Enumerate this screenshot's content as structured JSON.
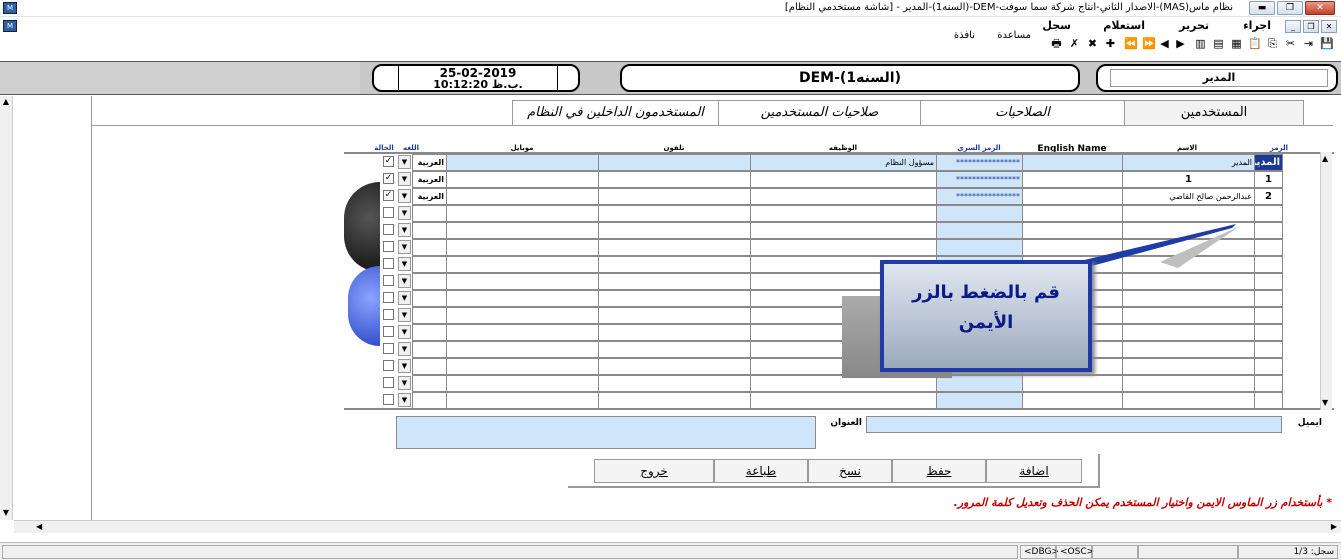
{
  "window": {
    "title": "نظام ماس(MAS)-الاصدار الثاني-انتاج شركة سما سوفت-DEM-(السنه1)-المدير - [شاشة مستخدمي النظام]"
  },
  "menu": [
    "اجراء",
    "تحرير",
    "استعلام",
    "سجل",
    "نافذة",
    "مساعدة"
  ],
  "header": {
    "date": "25-02-2019",
    "time": "10:12:20 ب.ظ.",
    "company": "DEM-(السنه1)",
    "user": "المدير"
  },
  "tabs": [
    "المستخدمين",
    "الصلاحيات",
    "صلاحيات المستخدمين",
    "المستخدمون الداخلين في النظام"
  ],
  "grid": {
    "columns": [
      "الرمز",
      "الاسم",
      "English Name",
      "الرمز السري",
      "الوظيفه",
      "تلفون",
      "موبايل",
      "اللغه",
      "الحالة"
    ],
    "rows": [
      {
        "code": "المدير",
        "name": "المدير",
        "english": "",
        "password": "****************",
        "job": "مسؤول النظام",
        "phone": "",
        "mobile": "",
        "lang": "العربية",
        "status": true
      },
      {
        "code": "1",
        "name": "1",
        "english": "",
        "password": "****************",
        "job": "",
        "phone": "",
        "mobile": "",
        "lang": "العربية",
        "status": true
      },
      {
        "code": "2",
        "name": "عبدالرحمن صالح القاضي",
        "english": "",
        "password": "****************",
        "job": "",
        "phone": "",
        "mobile": "",
        "lang": "العربية",
        "status": true
      }
    ]
  },
  "fields": {
    "email_label": "ايميل",
    "address_label": "العنوان"
  },
  "callout": "قم بالضغط بالزر الأيمن",
  "buttons": {
    "add": "اضافة",
    "save": "حفظ",
    "copy": "نسخ",
    "print": "طباعة",
    "exit": "خروج"
  },
  "note": "* بأستخدام زر الماوس الايمن واختيار المستخدم يمكن الحذف وتعديل كلمة المرور.",
  "status": {
    "record": "سجل: 1/3",
    "dbg": "<DBG>",
    "osc": "<OSC>"
  }
}
